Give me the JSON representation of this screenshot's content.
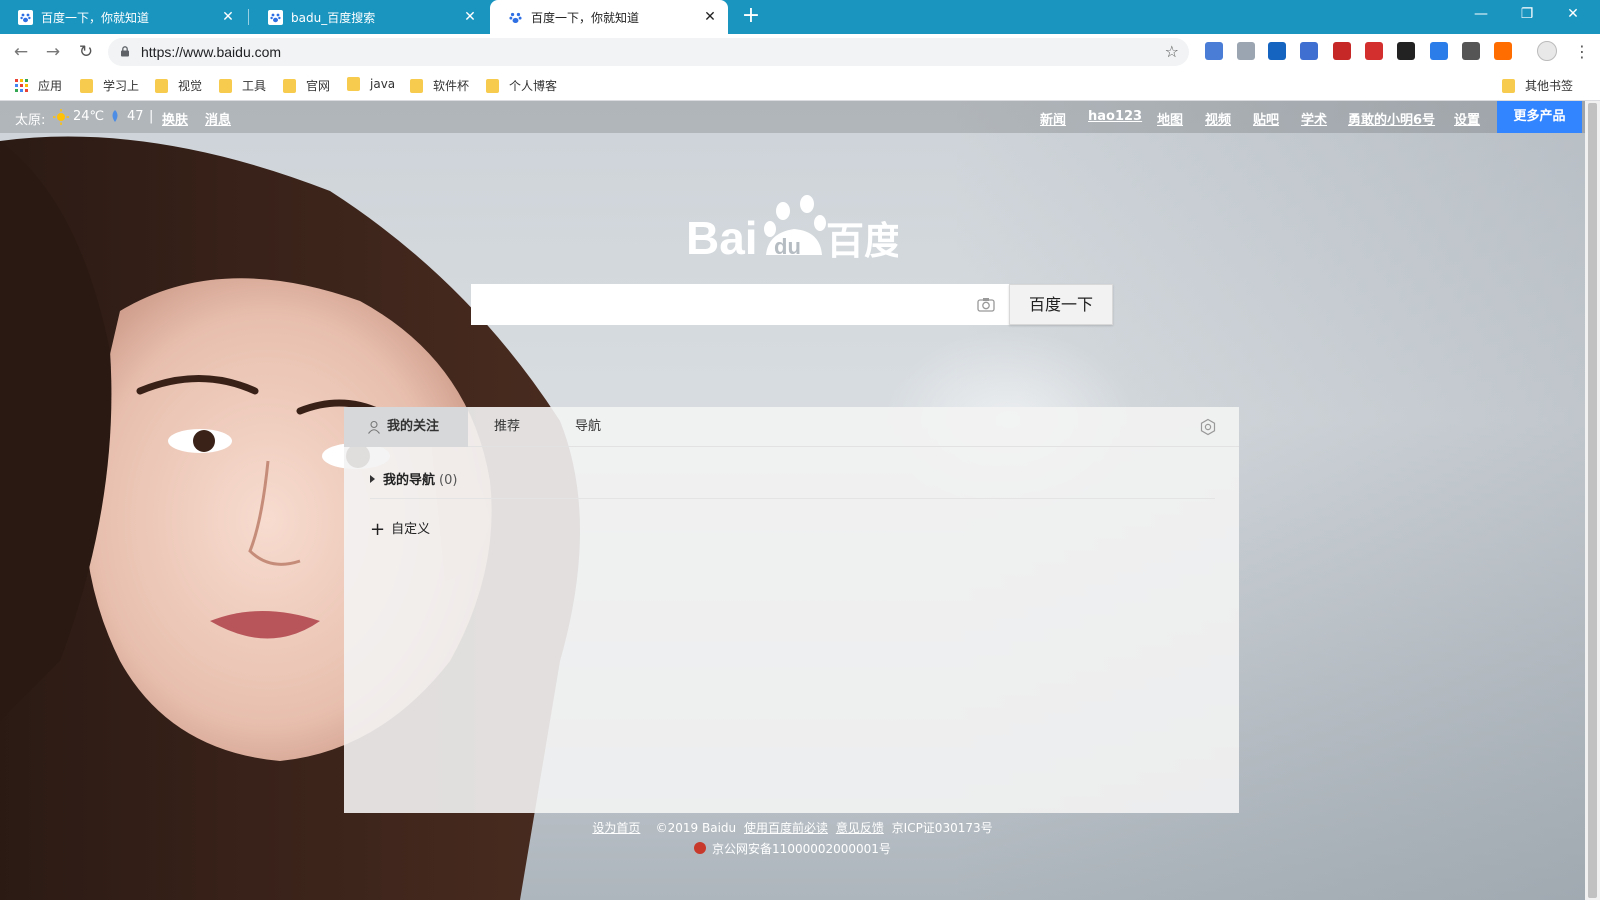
{
  "browser": {
    "tabs": [
      {
        "title": "百度一下，你就知道"
      },
      {
        "title": "badu_百度搜索"
      },
      {
        "title": "百度一下，你就知道"
      }
    ],
    "new_tab": "+",
    "window_controls": {
      "minimize": "—",
      "maximize": "❐",
      "close": "✕"
    },
    "nav": {
      "back": "←",
      "forward": "→",
      "reload": "↻"
    },
    "url": "https://www.baidu.com",
    "bookmark_star": "☆",
    "menu": "⋮",
    "extensions": [
      {
        "icon": "translate-extension-icon",
        "color": "#4a7dd6"
      },
      {
        "icon": "cursor-extension-icon",
        "color": "#9aa5b1"
      },
      {
        "icon": "y-extension-icon",
        "color": "#1565c0"
      },
      {
        "icon": "graduation-extension-icon",
        "color": "#3f6fd1"
      },
      {
        "icon": "adblock-extension-icon",
        "color": "#c62828"
      },
      {
        "icon": "password-extension-icon",
        "color": "#d32f2f"
      },
      {
        "icon": "panda-extension-icon",
        "color": "#222222"
      },
      {
        "icon": "send-extension-icon",
        "color": "#2b7de9"
      },
      {
        "icon": "cloud-extension-icon",
        "color": "#555555"
      },
      {
        "icon": "infinity-extension-icon",
        "color": "#ff6d00"
      }
    ],
    "bookmarks": [
      {
        "label": "应用"
      },
      {
        "label": "学习上"
      },
      {
        "label": "视觉"
      },
      {
        "label": "工具"
      },
      {
        "label": "官网"
      },
      {
        "label": "java"
      },
      {
        "label": "软件杯"
      },
      {
        "label": "个人博客"
      }
    ],
    "other_bookmarks": "其他书签"
  },
  "topbar": {
    "city": "太原:",
    "temperature": "24℃",
    "aqi": "47",
    "separator": "|",
    "skin": "换肤",
    "messages": "消息",
    "links": [
      "新闻",
      "hao123",
      "地图",
      "视频",
      "贴吧",
      "学术",
      "勇敢的小明6号",
      "设置"
    ],
    "more": "更多产品"
  },
  "logo": {
    "latin": "Bai",
    "paw": "du",
    "chinese": "百度"
  },
  "search": {
    "value": "",
    "button": "百度一下"
  },
  "panel": {
    "tabs": [
      "我的关注",
      "推荐",
      "导航"
    ],
    "nav_title": "我的导航",
    "nav_count": "(0)",
    "customize": "自定义"
  },
  "footer": {
    "set_home": "设为首页",
    "copyright": "©2019 Baidu",
    "terms": "使用百度前必读",
    "feedback": "意见反馈",
    "icp": "京ICP证030173号",
    "police": "京公网安备11000002000001号"
  },
  "colors": {
    "tabstrip": "#1a95c0",
    "more_button": "#3385ff",
    "bookmark_folder": "#f7cb4d"
  }
}
